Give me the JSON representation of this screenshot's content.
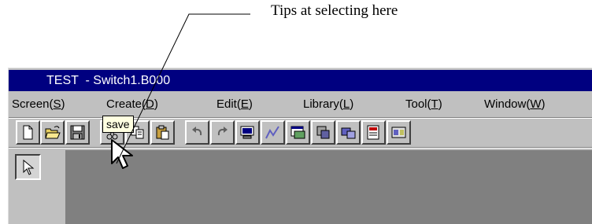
{
  "annotation": {
    "callout_text": "Tips at selecting here"
  },
  "window": {
    "title": "TEST  - Switch1.B000"
  },
  "menu": {
    "items": [
      {
        "label": "Screen(",
        "key": "S",
        "suffix": ")"
      },
      {
        "label": "Create(",
        "key": "D",
        "suffix": ")"
      },
      {
        "label": "Edit(",
        "key": "E",
        "suffix": ")"
      },
      {
        "label": "Library(",
        "key": "L",
        "suffix": ")"
      },
      {
        "label": "Tool(",
        "key": "T",
        "suffix": ")"
      },
      {
        "label": "Window(",
        "key": "W",
        "suffix": ")"
      }
    ]
  },
  "toolbar": {
    "buttons": [
      "new-file",
      "open-folder",
      "save",
      "cut",
      "copy",
      "paste",
      "undo",
      "redo",
      "screen-object",
      "line-graph",
      "object-a",
      "object-b",
      "object-c",
      "object-d",
      "object-e"
    ]
  },
  "tooltip": {
    "text": "save"
  },
  "colors": {
    "title_bar": "#000080",
    "face": "#c0c0c0",
    "workspace": "#808080",
    "tooltip_bg": "#ffffe1"
  }
}
